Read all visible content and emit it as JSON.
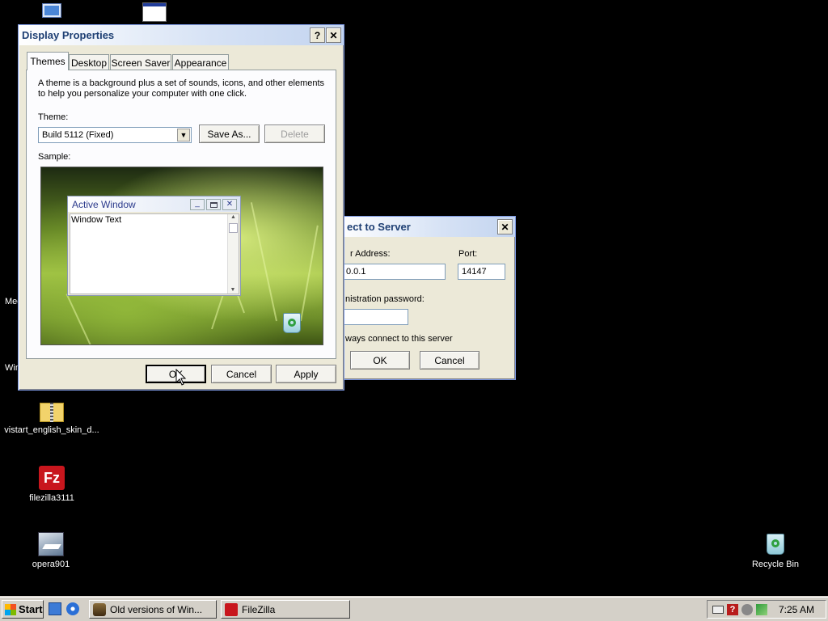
{
  "desktop": {
    "icons": [
      {
        "label": "vistart_english_skin_d...",
        "icon": "zip-folder-icon"
      },
      {
        "label": "filezilla3111",
        "icon": "filezilla-icon"
      },
      {
        "label": "opera901",
        "icon": "opera-installer-icon"
      },
      {
        "label": "Recycle Bin",
        "icon": "recycle-bin-icon"
      }
    ],
    "clipped_labels": [
      "Med",
      "Win"
    ]
  },
  "display_properties": {
    "title": "Display Properties",
    "help_button": "?",
    "close_button": "✕",
    "tabs": [
      "Themes",
      "Desktop",
      "Screen Saver",
      "Appearance"
    ],
    "active_tab": "Themes",
    "description": "A theme is a background plus a set of sounds, icons, and other elements to help you personalize your computer with one click.",
    "theme_label": "Theme:",
    "theme_value": "Build 5112 (Fixed)",
    "save_as": "Save As...",
    "delete": "Delete",
    "sample_label": "Sample:",
    "sample_window": {
      "title": "Active Window",
      "text": "Window Text"
    },
    "ok": "OK",
    "cancel": "Cancel",
    "apply": "Apply"
  },
  "connect_dialog": {
    "title": "ect to Server",
    "address_label": "r Address:",
    "address_value": "0.0.1",
    "port_label": "Port:",
    "port_value": "14147",
    "password_label": "nistration password:",
    "always_connect": "ways connect to this server",
    "ok": "OK",
    "cancel": "Cancel"
  },
  "taskbar": {
    "start": "Start",
    "tasks": [
      "Old versions of Win...",
      "FileZilla"
    ],
    "clock": "7:25 AM"
  },
  "colors": {
    "title_text": "#1e3f73",
    "sample_title": "#2b3a8c",
    "dialog_bg": "#ece9d8",
    "desktop_bg": "#000000"
  }
}
